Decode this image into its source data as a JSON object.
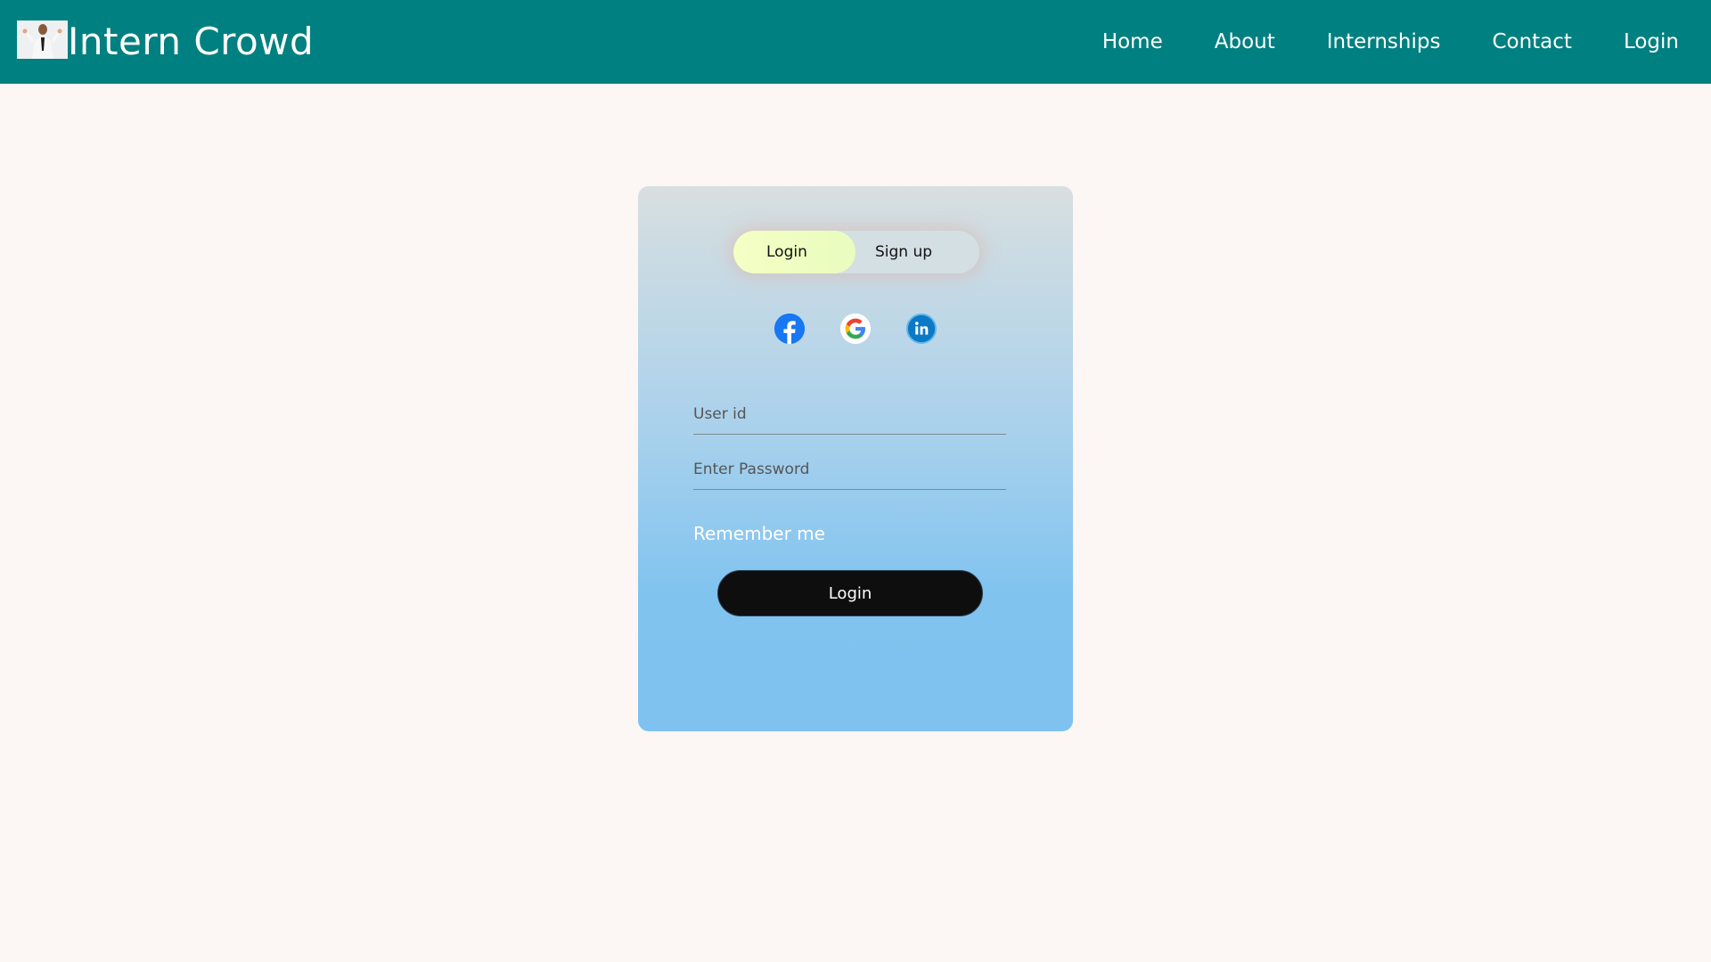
{
  "brand": {
    "name": "Intern Crowd"
  },
  "nav": {
    "items": [
      "Home",
      "About",
      "Internships",
      "Contact",
      "Login"
    ]
  },
  "auth": {
    "tabs": {
      "login": "Login",
      "signup": "Sign up",
      "active": "login"
    },
    "social": [
      "facebook-icon",
      "google-icon",
      "linkedin-icon"
    ],
    "user_placeholder": "User id",
    "password_placeholder": "Enter Password",
    "remember_label": "Remember me",
    "submit_label": "Login"
  },
  "colors": {
    "nav_bg": "#008080",
    "page_bg": "#fcf6f5",
    "button_bg": "#0e0e0e",
    "card_gradient_top": "#d8dfe0",
    "card_gradient_bottom": "#7fc2ef",
    "active_tab": "#f4ffc4"
  }
}
